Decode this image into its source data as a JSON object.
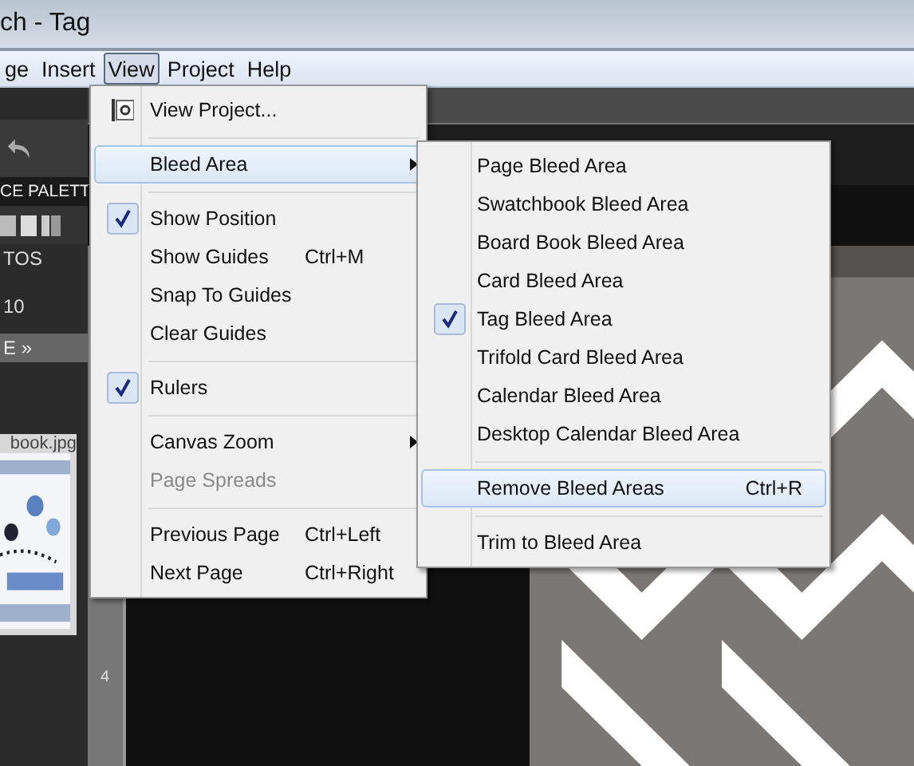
{
  "window": {
    "title": "ch - Tag"
  },
  "menubar": [
    {
      "label": "ge",
      "selected": false
    },
    {
      "label": "Insert",
      "selected": false
    },
    {
      "label": "View",
      "selected": true
    },
    {
      "label": "Project",
      "selected": false
    },
    {
      "label": "Help",
      "selected": false
    }
  ],
  "left_panel": {
    "palette_label": "CE PALETT",
    "section_label": "TOS",
    "count": "10",
    "page_label": "E »",
    "thumbnail": {
      "caption": "book.jpg",
      "kind": "picture"
    }
  },
  "ruler": {
    "label": "4"
  },
  "view_menu": {
    "items": [
      {
        "kind": "icon-item",
        "label": "View Project...",
        "selected": false
      },
      {
        "kind": "separator"
      },
      {
        "kind": "submenu",
        "label": "Bleed Area",
        "selected": true
      },
      {
        "kind": "separator"
      },
      {
        "kind": "item",
        "label": "Show Position",
        "checked": true
      },
      {
        "kind": "item",
        "label": "Show Guides",
        "shortcut": "Ctrl+M",
        "checked": false
      },
      {
        "kind": "item",
        "label": "Snap To Guides",
        "checked": false
      },
      {
        "kind": "item",
        "label": "Clear Guides",
        "checked": false
      },
      {
        "kind": "separator"
      },
      {
        "kind": "item",
        "label": "Rulers",
        "checked": true
      },
      {
        "kind": "separator"
      },
      {
        "kind": "submenu",
        "label": "Canvas Zoom",
        "selected": false
      },
      {
        "kind": "item",
        "label": "Page Spreads",
        "disabled": true
      },
      {
        "kind": "separator"
      },
      {
        "kind": "item",
        "label": "Previous Page",
        "shortcut": "Ctrl+Left"
      },
      {
        "kind": "item",
        "label": "Next Page",
        "shortcut": "Ctrl+Right"
      }
    ]
  },
  "bleed_menu": {
    "items": [
      {
        "kind": "item",
        "label": "Page Bleed Area",
        "checked": false
      },
      {
        "kind": "item",
        "label": "Swatchbook Bleed Area",
        "checked": false
      },
      {
        "kind": "item",
        "label": "Board Book Bleed Area",
        "checked": false
      },
      {
        "kind": "item",
        "label": "Card Bleed Area",
        "checked": false
      },
      {
        "kind": "item",
        "label": "Tag Bleed Area",
        "checked": true
      },
      {
        "kind": "item",
        "label": "Trifold Card Bleed Area",
        "checked": false
      },
      {
        "kind": "item",
        "label": "Calendar Bleed Area",
        "checked": false
      },
      {
        "kind": "item",
        "label": "Desktop Calendar Bleed Area",
        "checked": false
      },
      {
        "kind": "separator"
      },
      {
        "kind": "item",
        "label": "Remove Bleed Areas",
        "shortcut": "Ctrl+R",
        "selected": true
      },
      {
        "kind": "separator"
      },
      {
        "kind": "item",
        "label": "Trim to Bleed Area",
        "selected": false
      }
    ]
  }
}
